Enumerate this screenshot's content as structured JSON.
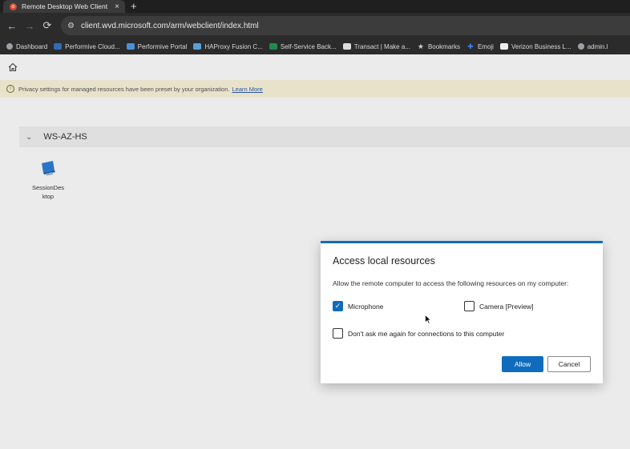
{
  "browser": {
    "tab_title": "Remote Desktop Web Client",
    "tab_close": "×",
    "new_tab": "+",
    "url": "client.wvd.microsoft.com/arm/webclient/index.html",
    "bookmarks": [
      {
        "label": "Dashboard",
        "icon": "globe-icon",
        "color": "#9aa0a6"
      },
      {
        "label": "Performive Cloud...",
        "icon": "vmware-icon",
        "color": "#2f6db5"
      },
      {
        "label": "Performive Portal",
        "icon": "performive-icon",
        "color": "#4a90d9"
      },
      {
        "label": "HAProxy Fusion C...",
        "icon": "haproxy-icon",
        "color": "#5aa0d8"
      },
      {
        "label": "Self-Service Back...",
        "icon": "green-dot-icon",
        "color": "#1f8a4c"
      },
      {
        "label": "Transact | Make a...",
        "icon": "transact-icon",
        "color": "#dddddd"
      },
      {
        "label": "Bookmarks",
        "icon": "star-icon",
        "color": "#cfcfcf"
      },
      {
        "label": "Emoji",
        "icon": "plus-cross-icon",
        "color": "#3b82f6"
      },
      {
        "label": "Verizon Business L...",
        "icon": "verizon-icon",
        "color": "#eeeeee"
      },
      {
        "label": "admin.l",
        "icon": "globe-icon",
        "color": "#9aa0a6"
      }
    ]
  },
  "page": {
    "banner_text": "Privacy settings for managed resources have been preset by your organization.",
    "banner_link": "Learn More",
    "group_name": "WS-AZ-HS",
    "resource_line1": "SessionDes",
    "resource_line2": "ktop"
  },
  "dialog": {
    "title": "Access local resources",
    "description": "Allow the remote computer to access the following resources on my computer:",
    "microphone_label": "Microphone",
    "microphone_checked": true,
    "camera_label": "Camera [Preview]",
    "camera_checked": false,
    "dont_ask_label": "Don't ask me again for connections to this computer",
    "dont_ask_checked": false,
    "allow_label": "Allow",
    "cancel_label": "Cancel"
  },
  "colors": {
    "accent": "#0f6cbd",
    "banner_bg": "#fdf6dd"
  }
}
